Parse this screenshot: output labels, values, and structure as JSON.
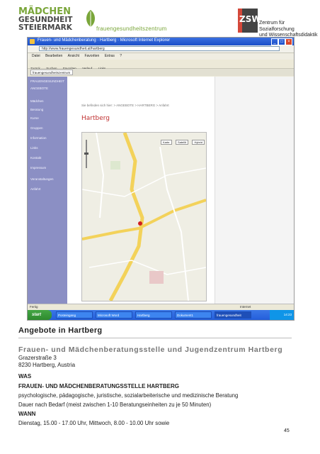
{
  "header": {
    "logo_line1": "MÄDCHEN",
    "logo_line2": "GESUNDHEIT",
    "logo_line3": "STEIERMARK",
    "logo_sub": "frauengesundheitszentrum",
    "right_logo": "ZSW",
    "right_title_line1": "Zentrum für Sozialforschung",
    "right_title_line2": "und Wissenschaftsdidaktik",
    "brand_green": "#7aa63a"
  },
  "browser": {
    "window_title": "Frauen- und Mädchenberatung · Hartberg · Microsoft Internet Explorer",
    "address": "http://www.frauengesundheit.at/hartberg",
    "menu": [
      "Datei",
      "Bearbeiten",
      "Ansicht",
      "Favoriten",
      "Extras",
      "?"
    ],
    "toolbar": [
      "Zurück",
      "Suchen",
      "Favoriten",
      "Verlauf",
      "Links"
    ],
    "tab_label": "frauengesundheitszentrum",
    "sidebar_items": [
      "FRAUENGESUNDHEIT",
      "ANGEBOTE",
      "Mädchen",
      "Beratung",
      "Kurse",
      "Gruppen",
      "Information",
      "Links",
      "Kontakt",
      "Impressum",
      "Veranstaltungen",
      "Anfahrt"
    ],
    "breadcrumb": "Sie befinden sich hier: > ANGEBOTE > HARTBERG > Anfahrt",
    "content_title": "Hartberg",
    "map_buttons": [
      "Karte",
      "Satellit",
      "Hybrid"
    ],
    "status_left": "Fertig",
    "status_right": "Internet",
    "taskbar_start": "start",
    "taskbar_tasks": [
      "Posteingang",
      "Microsoft Word",
      "Hartberg",
      "Dokument1",
      "frauengesundheit"
    ],
    "taskbar_time": "14:23"
  },
  "section": {
    "title": "Angebote in Hartberg",
    "org": "Frauen- und Mädchenberatungsstelle und Jugendzentrum Hartberg",
    "street": "Grazerstraße 3",
    "city": "8230 Hartberg, Austria",
    "was_label": "WAS",
    "org_name": "FRAUEN- UND MÄDCHENBERATUNGSSTELLE HARTBERG",
    "description": "psychologische, pädagogische, juristische, sozialarbeiterische und medizinische Beratung",
    "need": "Dauer nach Bedarf (meist zwischen 1-10 Beratungseinheiten zu je 50 Minuten)",
    "wann_label": "WANN",
    "times": "Dienstag, 15.00 - 17.00 Uhr, Mittwoch, 8.00 - 10.00 Uhr sowie"
  },
  "page_number": "45"
}
